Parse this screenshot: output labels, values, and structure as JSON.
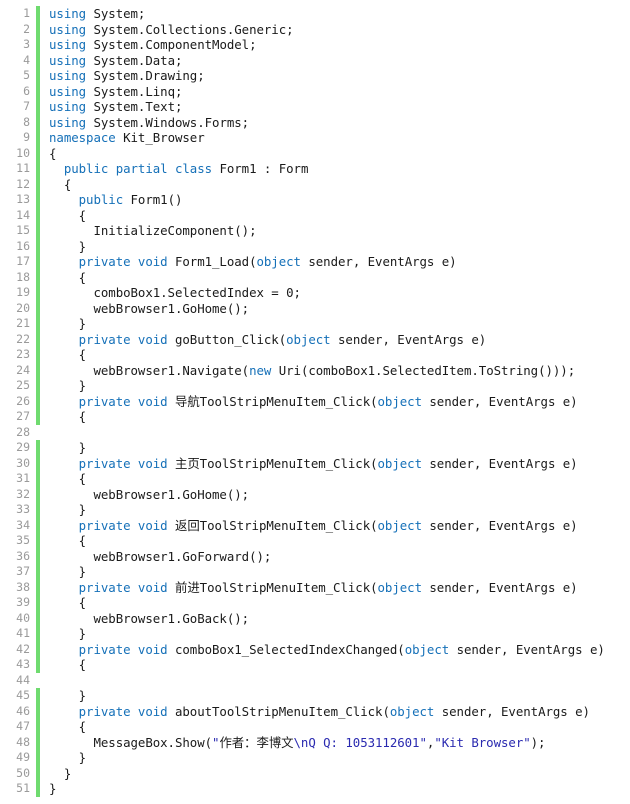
{
  "editor": {
    "kind": "code-editor",
    "language": "C#",
    "background": "#ffffff",
    "line_number_color": "#9a9a9a",
    "change_bar_color": "#6fdb6f",
    "keyword_color": "#1570b8",
    "string_color": "#2a2ab0",
    "plain_color": "#1a1a1a",
    "first_line": 1,
    "last_line": 51,
    "total_lines": 51
  },
  "lines": [
    {
      "n": "1",
      "changed": true,
      "tokens": [
        {
          "t": "kw",
          "v": "using"
        },
        {
          "t": "pln",
          "v": " System;"
        }
      ]
    },
    {
      "n": "2",
      "changed": true,
      "tokens": [
        {
          "t": "kw",
          "v": "using"
        },
        {
          "t": "pln",
          "v": " System.Collections.Generic;"
        }
      ]
    },
    {
      "n": "3",
      "changed": true,
      "tokens": [
        {
          "t": "kw",
          "v": "using"
        },
        {
          "t": "pln",
          "v": " System.ComponentModel;"
        }
      ]
    },
    {
      "n": "4",
      "changed": true,
      "tokens": [
        {
          "t": "kw",
          "v": "using"
        },
        {
          "t": "pln",
          "v": " System.Data;"
        }
      ]
    },
    {
      "n": "5",
      "changed": true,
      "tokens": [
        {
          "t": "kw",
          "v": "using"
        },
        {
          "t": "pln",
          "v": " System.Drawing;"
        }
      ]
    },
    {
      "n": "6",
      "changed": true,
      "tokens": [
        {
          "t": "kw",
          "v": "using"
        },
        {
          "t": "pln",
          "v": " System.Linq;"
        }
      ]
    },
    {
      "n": "7",
      "changed": true,
      "tokens": [
        {
          "t": "kw",
          "v": "using"
        },
        {
          "t": "pln",
          "v": " System.Text;"
        }
      ]
    },
    {
      "n": "8",
      "changed": true,
      "tokens": [
        {
          "t": "kw",
          "v": "using"
        },
        {
          "t": "pln",
          "v": " System.Windows.Forms;"
        }
      ]
    },
    {
      "n": "9",
      "changed": true,
      "tokens": [
        {
          "t": "kw",
          "v": "namespace"
        },
        {
          "t": "pln",
          "v": " Kit_Browser"
        }
      ]
    },
    {
      "n": "10",
      "changed": true,
      "tokens": [
        {
          "t": "pln",
          "v": "{"
        }
      ]
    },
    {
      "n": "11",
      "changed": true,
      "tokens": [
        {
          "t": "kw",
          "v": "  public partial class"
        },
        {
          "t": "pln",
          "v": " Form1 : Form"
        }
      ]
    },
    {
      "n": "12",
      "changed": true,
      "tokens": [
        {
          "t": "pln",
          "v": "  {"
        }
      ]
    },
    {
      "n": "13",
      "changed": true,
      "tokens": [
        {
          "t": "kw",
          "v": "    public"
        },
        {
          "t": "pln",
          "v": " Form1()"
        }
      ]
    },
    {
      "n": "14",
      "changed": true,
      "tokens": [
        {
          "t": "pln",
          "v": "    {"
        }
      ]
    },
    {
      "n": "15",
      "changed": true,
      "tokens": [
        {
          "t": "pln",
          "v": "      InitializeComponent();"
        }
      ]
    },
    {
      "n": "16",
      "changed": true,
      "tokens": [
        {
          "t": "pln",
          "v": "    }"
        }
      ]
    },
    {
      "n": "17",
      "changed": true,
      "tokens": [
        {
          "t": "kw",
          "v": "    private void"
        },
        {
          "t": "pln",
          "v": " Form1_Load("
        },
        {
          "t": "kw",
          "v": "object"
        },
        {
          "t": "pln",
          "v": " sender, EventArgs e)"
        }
      ]
    },
    {
      "n": "18",
      "changed": true,
      "tokens": [
        {
          "t": "pln",
          "v": "    {"
        }
      ]
    },
    {
      "n": "19",
      "changed": true,
      "tokens": [
        {
          "t": "pln",
          "v": "      comboBox1.SelectedIndex = 0;"
        }
      ]
    },
    {
      "n": "20",
      "changed": true,
      "tokens": [
        {
          "t": "pln",
          "v": "      webBrowser1.GoHome();"
        }
      ]
    },
    {
      "n": "21",
      "changed": true,
      "tokens": [
        {
          "t": "pln",
          "v": "    }"
        }
      ]
    },
    {
      "n": "22",
      "changed": true,
      "tokens": [
        {
          "t": "kw",
          "v": "    private void"
        },
        {
          "t": "pln",
          "v": " goButton_Click("
        },
        {
          "t": "kw",
          "v": "object"
        },
        {
          "t": "pln",
          "v": " sender, EventArgs e)"
        }
      ]
    },
    {
      "n": "23",
      "changed": true,
      "tokens": [
        {
          "t": "pln",
          "v": "    {"
        }
      ]
    },
    {
      "n": "24",
      "changed": true,
      "tokens": [
        {
          "t": "pln",
          "v": "      webBrowser1.Navigate("
        },
        {
          "t": "kw",
          "v": "new"
        },
        {
          "t": "pln",
          "v": " Uri(comboBox1.SelectedItem.ToString()));"
        }
      ]
    },
    {
      "n": "25",
      "changed": true,
      "tokens": [
        {
          "t": "pln",
          "v": "    }"
        }
      ]
    },
    {
      "n": "26",
      "changed": true,
      "tokens": [
        {
          "t": "kw",
          "v": "    private void"
        },
        {
          "t": "pln",
          "v": " "
        },
        {
          "t": "cjk",
          "v": "导航"
        },
        {
          "t": "pln",
          "v": "ToolStripMenuItem_Click("
        },
        {
          "t": "kw",
          "v": "object"
        },
        {
          "t": "pln",
          "v": " sender, EventArgs e)"
        }
      ]
    },
    {
      "n": "27",
      "changed": true,
      "tokens": [
        {
          "t": "pln",
          "v": "    {"
        }
      ]
    },
    {
      "n": "28",
      "changed": false,
      "tokens": [
        {
          "t": "pln",
          "v": ""
        }
      ]
    },
    {
      "n": "29",
      "changed": true,
      "tokens": [
        {
          "t": "pln",
          "v": "    }"
        }
      ]
    },
    {
      "n": "30",
      "changed": true,
      "tokens": [
        {
          "t": "kw",
          "v": "    private void"
        },
        {
          "t": "pln",
          "v": " "
        },
        {
          "t": "cjk",
          "v": "主页"
        },
        {
          "t": "pln",
          "v": "ToolStripMenuItem_Click("
        },
        {
          "t": "kw",
          "v": "object"
        },
        {
          "t": "pln",
          "v": " sender, EventArgs e)"
        }
      ]
    },
    {
      "n": "31",
      "changed": true,
      "tokens": [
        {
          "t": "pln",
          "v": "    {"
        }
      ]
    },
    {
      "n": "32",
      "changed": true,
      "tokens": [
        {
          "t": "pln",
          "v": "      webBrowser1.GoHome();"
        }
      ]
    },
    {
      "n": "33",
      "changed": true,
      "tokens": [
        {
          "t": "pln",
          "v": "    }"
        }
      ]
    },
    {
      "n": "34",
      "changed": true,
      "tokens": [
        {
          "t": "kw",
          "v": "    private void"
        },
        {
          "t": "pln",
          "v": " "
        },
        {
          "t": "cjk",
          "v": "返回"
        },
        {
          "t": "pln",
          "v": "ToolStripMenuItem_Click("
        },
        {
          "t": "kw",
          "v": "object"
        },
        {
          "t": "pln",
          "v": " sender, EventArgs e)"
        }
      ]
    },
    {
      "n": "35",
      "changed": true,
      "tokens": [
        {
          "t": "pln",
          "v": "    {"
        }
      ]
    },
    {
      "n": "36",
      "changed": true,
      "tokens": [
        {
          "t": "pln",
          "v": "      webBrowser1.GoForward();"
        }
      ]
    },
    {
      "n": "37",
      "changed": true,
      "tokens": [
        {
          "t": "pln",
          "v": "    }"
        }
      ]
    },
    {
      "n": "38",
      "changed": true,
      "tokens": [
        {
          "t": "kw",
          "v": "    private void"
        },
        {
          "t": "pln",
          "v": " "
        },
        {
          "t": "cjk",
          "v": "前进"
        },
        {
          "t": "pln",
          "v": "ToolStripMenuItem_Click("
        },
        {
          "t": "kw",
          "v": "object"
        },
        {
          "t": "pln",
          "v": " sender, EventArgs e)"
        }
      ]
    },
    {
      "n": "39",
      "changed": true,
      "tokens": [
        {
          "t": "pln",
          "v": "    {"
        }
      ]
    },
    {
      "n": "40",
      "changed": true,
      "tokens": [
        {
          "t": "pln",
          "v": "      webBrowser1.GoBack();"
        }
      ]
    },
    {
      "n": "41",
      "changed": true,
      "tokens": [
        {
          "t": "pln",
          "v": "    }"
        }
      ]
    },
    {
      "n": "42",
      "changed": true,
      "tokens": [
        {
          "t": "kw",
          "v": "    private void"
        },
        {
          "t": "pln",
          "v": " comboBox1_SelectedIndexChanged("
        },
        {
          "t": "kw",
          "v": "object"
        },
        {
          "t": "pln",
          "v": " sender, EventArgs e)"
        }
      ]
    },
    {
      "n": "43",
      "changed": true,
      "tokens": [
        {
          "t": "pln",
          "v": "    {"
        }
      ]
    },
    {
      "n": "44",
      "changed": false,
      "tokens": [
        {
          "t": "pln",
          "v": ""
        }
      ]
    },
    {
      "n": "45",
      "changed": true,
      "tokens": [
        {
          "t": "pln",
          "v": "    }"
        }
      ]
    },
    {
      "n": "46",
      "changed": true,
      "tokens": [
        {
          "t": "kw",
          "v": "    private void"
        },
        {
          "t": "pln",
          "v": " aboutToolStripMenuItem_Click("
        },
        {
          "t": "kw",
          "v": "object"
        },
        {
          "t": "pln",
          "v": " sender, EventArgs e)"
        }
      ]
    },
    {
      "n": "47",
      "changed": true,
      "tokens": [
        {
          "t": "pln",
          "v": "    {"
        }
      ]
    },
    {
      "n": "48",
      "changed": true,
      "tokens": [
        {
          "t": "pln",
          "v": "      MessageBox.Show("
        },
        {
          "t": "str",
          "v": "\""
        },
        {
          "t": "strcjk",
          "v": "作者：李博文"
        },
        {
          "t": "str",
          "v": "\\nQ Q: 1053112601\""
        },
        {
          "t": "pln",
          "v": ","
        },
        {
          "t": "str",
          "v": "\"Kit Browser\""
        },
        {
          "t": "pln",
          "v": ");"
        }
      ]
    },
    {
      "n": "49",
      "changed": true,
      "tokens": [
        {
          "t": "pln",
          "v": "    }"
        }
      ]
    },
    {
      "n": "50",
      "changed": true,
      "tokens": [
        {
          "t": "pln",
          "v": "  }"
        }
      ]
    },
    {
      "n": "51",
      "changed": true,
      "tokens": [
        {
          "t": "pln",
          "v": "}"
        }
      ]
    }
  ]
}
